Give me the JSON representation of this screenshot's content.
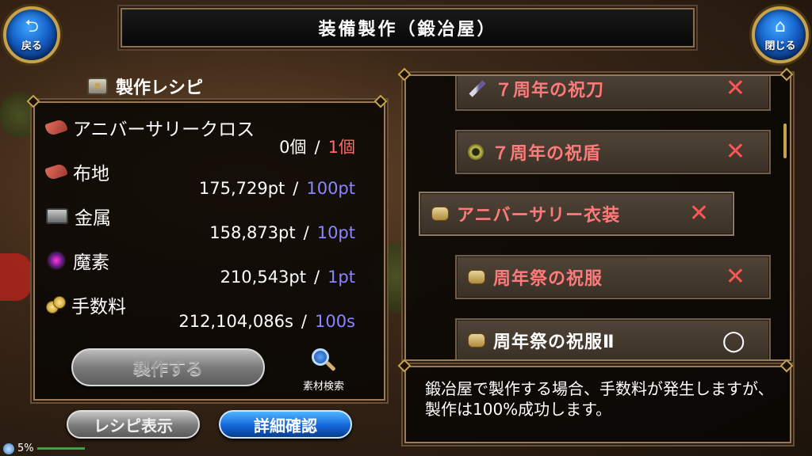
{
  "header": {
    "title": "装備製作（鍛冶屋）",
    "back_label": "戻る",
    "close_label": "閉じる"
  },
  "recipe": {
    "heading": "製作レシピ",
    "materials": [
      {
        "name": "アニバーサリークロス",
        "have": "0個",
        "sep": "/",
        "need": "1個",
        "need_color": "#ff6a6a"
      },
      {
        "name": "布地",
        "have": "175,729pt",
        "sep": "/",
        "need": "100pt",
        "need_color": "#8a86ff"
      },
      {
        "name": "金属",
        "have": "158,873pt",
        "sep": "/",
        "need": "10pt",
        "need_color": "#8a86ff"
      },
      {
        "name": "魔素",
        "have": "210,543pt",
        "sep": "/",
        "need": "1pt",
        "need_color": "#8a86ff"
      },
      {
        "name": "手数料",
        "have": "212,104,086s",
        "sep": "/",
        "need": "100s",
        "need_color": "#8a86ff"
      }
    ],
    "make_button": "製作する",
    "search_label": "素材検索",
    "recipe_view_button": "レシピ表示",
    "detail_button": "詳細確認"
  },
  "list": {
    "items": [
      {
        "name": "７周年の祝刀",
        "icon": "sword-icon",
        "mark": "✕",
        "craftable": false
      },
      {
        "name": "７周年の祝盾",
        "icon": "shield-icon",
        "mark": "✕",
        "craftable": false
      },
      {
        "name": "アニバーサリー衣装",
        "icon": "scroll-icon",
        "mark": "✕",
        "craftable": false
      },
      {
        "name": "周年祭の祝服",
        "icon": "scroll-icon",
        "mark": "✕",
        "craftable": false
      },
      {
        "name": "周年祭の祝服Ⅱ",
        "icon": "scroll-icon",
        "mark": "○",
        "craftable": true
      }
    ]
  },
  "info": {
    "text": "鍛冶屋で製作する場合、手数料が発生しますが、製作は100%成功します。"
  },
  "status": {
    "percent": "5%"
  },
  "colors": {
    "accent_gold": "#c8a24a",
    "not_craftable": "#ff6a6a",
    "required_pt": "#8a86ff"
  }
}
